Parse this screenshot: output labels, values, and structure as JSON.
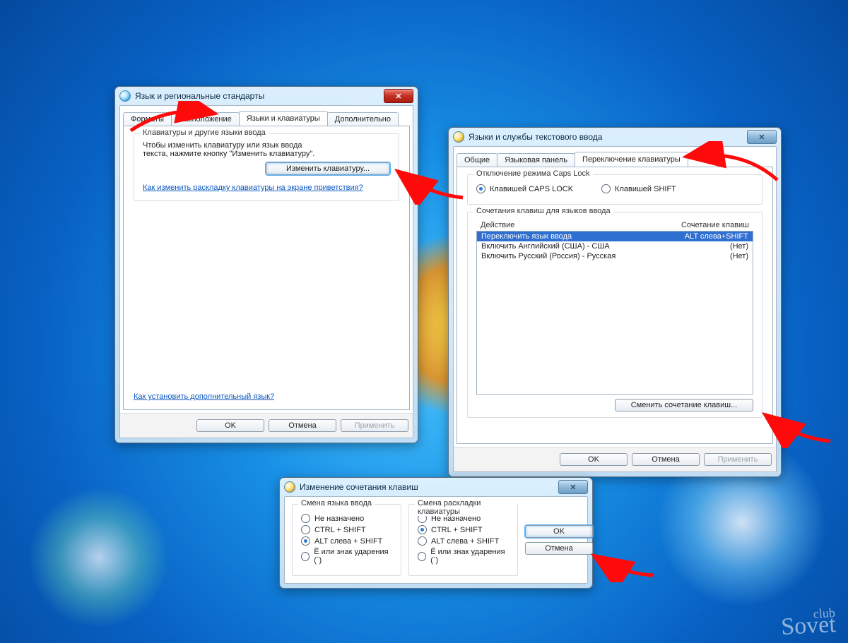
{
  "dialog1": {
    "title": "Язык и региональные стандарты",
    "tabs": [
      "Форматы",
      "Расположение",
      "Языки и клавиатуры",
      "Дополнительно"
    ],
    "group_heading": "Клавиатуры и другие языки ввода",
    "group_text": "Чтобы изменить клавиатуру или язык ввода текста, нажмите кнопку \"Изменить клавиатуру\".",
    "change_kb_btn": "Изменить клавиатуру...",
    "link1": "Как изменить раскладку клавиатуры на экране приветствия?",
    "link2": "Как установить дополнительный язык?",
    "ok": "OK",
    "cancel": "Отмена",
    "apply": "Применить"
  },
  "dialog2": {
    "title": "Языки и службы текстового ввода",
    "tabs": [
      "Общие",
      "Языковая панель",
      "Переключение клавиатуры"
    ],
    "caps_group": "Отключение режима Caps Lock",
    "caps_radio1": "Клавишей CAPS LOCK",
    "caps_radio2": "Клавишей SHIFT",
    "hotkeys_group": "Сочетания клавиш для языков ввода",
    "col_action": "Действие",
    "col_hotkey": "Сочетание клавиш",
    "rows": [
      {
        "action": "Переключить язык ввода",
        "hotkey": "ALT слева+SHIFT",
        "selected": true
      },
      {
        "action": "Включить Английский (США) - США",
        "hotkey": "(Нет)",
        "selected": false
      },
      {
        "action": "Включить Русский (Россия) - Русская",
        "hotkey": "(Нет)",
        "selected": false
      }
    ],
    "change_btn": "Сменить сочетание клавиш...",
    "ok": "OK",
    "cancel": "Отмена",
    "apply": "Применить"
  },
  "dialog3": {
    "title": "Изменение сочетания клавиш",
    "left_group": "Смена языка ввода",
    "right_group": "Смена раскладки клавиатуры",
    "opt_none": "Не назначено",
    "opt_ctrl": "CTRL + SHIFT",
    "opt_alt": "ALT слева + SHIFT",
    "opt_e": "Ё или знак ударения (`)",
    "ok": "OK",
    "cancel": "Отмена"
  },
  "watermark": {
    "small": "club",
    "big": "Sovet"
  }
}
